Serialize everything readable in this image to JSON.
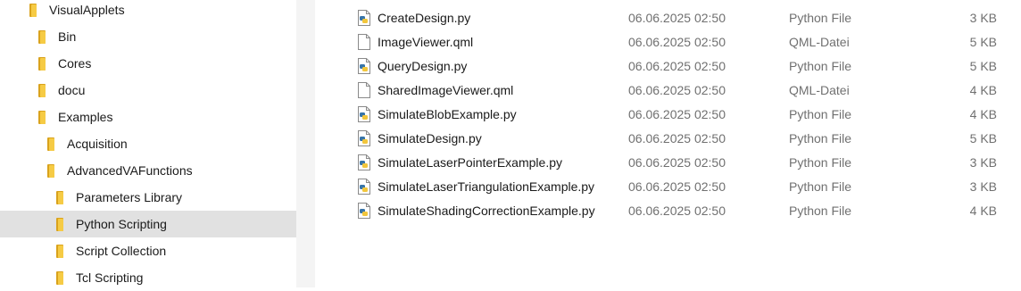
{
  "tree": [
    {
      "label": "VisualApplets",
      "selected": false
    },
    {
      "label": "Bin",
      "selected": false
    },
    {
      "label": "Cores",
      "selected": false
    },
    {
      "label": "docu",
      "selected": false
    },
    {
      "label": "Examples",
      "selected": false
    },
    {
      "label": "Acquisition",
      "selected": false
    },
    {
      "label": "AdvancedVAFunctions",
      "selected": false
    },
    {
      "label": "Parameters Library",
      "selected": false
    },
    {
      "label": "Python Scripting",
      "selected": true
    },
    {
      "label": "Script Collection",
      "selected": false
    },
    {
      "label": "Tcl Scripting",
      "selected": false
    }
  ],
  "files": [
    {
      "name": "CreateDesign.py",
      "date": "06.06.2025 02:50",
      "type": "Python File",
      "size": "3 KB",
      "icon": "python-file-icon"
    },
    {
      "name": "ImageViewer.qml",
      "date": "06.06.2025 02:50",
      "type": "QML-Datei",
      "size": "5 KB",
      "icon": "document-icon"
    },
    {
      "name": "QueryDesign.py",
      "date": "06.06.2025 02:50",
      "type": "Python File",
      "size": "5 KB",
      "icon": "python-file-icon"
    },
    {
      "name": "SharedImageViewer.qml",
      "date": "06.06.2025 02:50",
      "type": "QML-Datei",
      "size": "4 KB",
      "icon": "document-icon"
    },
    {
      "name": "SimulateBlobExample.py",
      "date": "06.06.2025 02:50",
      "type": "Python File",
      "size": "4 KB",
      "icon": "python-file-icon"
    },
    {
      "name": "SimulateDesign.py",
      "date": "06.06.2025 02:50",
      "type": "Python File",
      "size": "5 KB",
      "icon": "python-file-icon"
    },
    {
      "name": "SimulateLaserPointerExample.py",
      "date": "06.06.2025 02:50",
      "type": "Python File",
      "size": "3 KB",
      "icon": "python-file-icon"
    },
    {
      "name": "SimulateLaserTriangulationExample.py",
      "date": "06.06.2025 02:50",
      "type": "Python File",
      "size": "3 KB",
      "icon": "python-file-icon"
    },
    {
      "name": "SimulateShadingCorrectionExample.py",
      "date": "06.06.2025 02:50",
      "type": "Python File",
      "size": "4 KB",
      "icon": "python-file-icon"
    }
  ],
  "colors": {
    "selection": "#e1e1e1",
    "splitter": "#f4f4f4",
    "folder_front": "#f6cb45",
    "folder_back": "#d9a21c",
    "secondary_text": "#707070"
  }
}
